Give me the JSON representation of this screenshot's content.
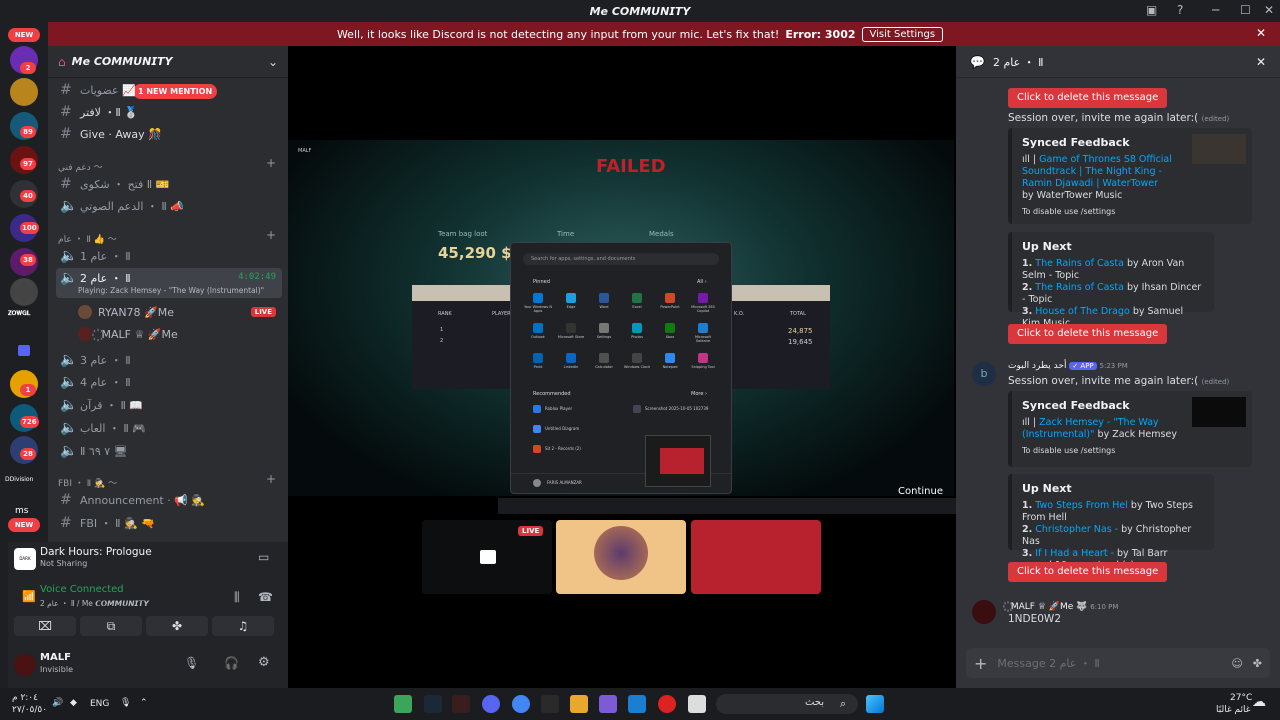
{
  "window": {
    "title": "Me 𝘾𝙊𝙈𝙈𝙐𝙉𝙄𝙏𝙔",
    "minimize": "─",
    "maximize": "☐",
    "close": "✕"
  },
  "banner": {
    "message": "Well, it looks like Discord is not detecting any input from your mic. Let's fix that!",
    "error": "Error: 3002",
    "button": "Visit Settings"
  },
  "servers": [
    {
      "badge": "NEW"
    },
    {
      "badge": "2"
    },
    {
      "badge": ""
    },
    {
      "badge": "89"
    },
    {
      "badge": "97"
    },
    {
      "badge": "40"
    },
    {
      "badge": "100"
    },
    {
      "badge": "38"
    },
    {
      "badge": "",
      "label": "𝐙𝐎𝐖𝐆𝐋"
    },
    {
      "badge": ""
    },
    {
      "badge": "1"
    },
    {
      "badge": "726"
    },
    {
      "badge": "28"
    },
    {
      "badge": "",
      "label": "DDivision"
    },
    {
      "badge": "NEW",
      "label": "ms"
    }
  ],
  "server_name": "Me 𝘾𝙊𝙈𝙈𝙐𝙉𝙄𝙏𝙔",
  "mention_pill": "1 NEW MENTION",
  "channels": [
    {
      "icon": "#",
      "name": "عضويات 📈"
    },
    {
      "icon": "#",
      "name": "لافتر ・Ⅱ 🥈"
    },
    {
      "icon": "#",
      "name": "Give · Away 🎊"
    },
    {
      "icon": "cat",
      "name": "دعم فني 〜"
    },
    {
      "icon": "#",
      "name": "فتح ・ شكوى Ⅱ 🎫"
    },
    {
      "icon": "spk",
      "name": "الدعم الصوتي ・ Ⅱ 📣"
    },
    {
      "icon": "cat",
      "name": "عام ・ Ⅱ 👍 〜"
    },
    {
      "icon": "spk",
      "name": "عام 1 ・ Ⅱ"
    },
    {
      "icon": "spk",
      "name": "عام 2 ・ Ⅱ"
    },
    {
      "icon": "spk",
      "name": "عام 3 ・ Ⅱ"
    },
    {
      "icon": "spk",
      "name": "عام 4 ・ Ⅱ"
    },
    {
      "icon": "spk",
      "name": "قرآن ・ Ⅱ 📖"
    },
    {
      "icon": "spk",
      "name": "العاب ・ Ⅱ 🎮"
    },
    {
      "icon": "spk",
      "name": "Ⅱ ٧ ٦٩ 🖥"
    },
    {
      "icon": "cat",
      "name": "FBI ・ Ⅱ 🕵 〜"
    },
    {
      "icon": "#",
      "name": "Announcement · 📢 🕵"
    },
    {
      "icon": "#",
      "name": "FBI ・ Ⅱ 🕵 🔫"
    }
  ],
  "active_channel": {
    "timer": "4:02:49",
    "activity": "Playing: Zack Hemsey - \"The Way (Instrumental)\""
  },
  "voice_users": [
    {
      "name": "RYAN78 🚀Me",
      "live": "LIVE"
    },
    {
      "name": "꙰ MALF ♕ 🚀Me",
      "live": ""
    }
  ],
  "activity": {
    "title": "Dark Hours: Prologue",
    "subtitle": "Not Sharing",
    "icon_text": "DARK HOURS"
  },
  "voice": {
    "status": "Voice Connected",
    "location": "عام 2 ・ Ⅱ / Me 𝘾𝙊𝙈𝙈𝙐𝙉𝙄𝙏𝙔"
  },
  "user": {
    "name": "MALF",
    "status": "Invisible"
  },
  "game": {
    "failed": "FAILED",
    "loot_label": "Team bag loot",
    "loot": "45,290 $",
    "time_label": "Time",
    "medals_label": "Medals",
    "col_rank": "RANK",
    "col_player": "PLAYER",
    "col_ko": "K.O.",
    "col_total": "TOTAL",
    "rows": [
      {
        "rank": "1",
        "total": "24,875"
      },
      {
        "rank": "2",
        "total": "19,645"
      }
    ],
    "continue": "Continue",
    "hud_name": "MALF"
  },
  "startmenu": {
    "search": "Search for apps, settings, and documents",
    "pinned": "Pinned",
    "all": "All ›",
    "recommended": "Recommended",
    "more": "More ›",
    "user": "FARIS ALMANZAR",
    "apps": [
      "Your Windows N Apps",
      "Edge",
      "Word",
      "Excel",
      "PowerPoint",
      "Microsoft 365 Copilot",
      "Outlook",
      "Microsoft Store",
      "Settings",
      "Photos",
      "Xbox",
      "Microsoft Solitaire",
      "Paint",
      "LinkedIn",
      "Calculator",
      "Windows Clock",
      "Notepad",
      "Snipping Tool"
    ],
    "recs": [
      "Roblox Player",
      "Untitled Diagram",
      "Sit 2 - Records (2)",
      "Screenshot 2025-10-05 102739"
    ]
  },
  "stream_thumbs": {
    "live": "LIVE"
  },
  "thread": {
    "title": "عام 2 ・ Ⅱ",
    "delete_label": "Click to delete this message",
    "session_over": "Session over, invite me again later:(",
    "edited": "(edited)",
    "bot_name": "أحد يطرد البوت",
    "app_tag": "✓ APP",
    "bot_time": "5:23 PM",
    "embed1": {
      "title": "Synced Feedback",
      "link": "Game of Thrones S8 Official Soundtrack | The Night King - Ramin Djawadi | WaterTower",
      "by": " by WaterTower Music",
      "footer": "To disable use /settings"
    },
    "upnext1": {
      "title": "Up Next",
      "items": [
        [
          "1.",
          "The Rains of Casta",
          " by Aron Van Selm - Topic"
        ],
        [
          "2.",
          "The Rains of Casta",
          " by Ihsan Dincer - Topic"
        ],
        [
          "3.",
          "House of The Drago",
          " by Samuel Kim Music"
        ]
      ],
      "more": "... and 20 more track(s)"
    },
    "embed2": {
      "title": "Synced Feedback",
      "link": "Zack Hemsey - \"The Way (Instrumental)\"",
      "by": " by Zack Hemsey",
      "footer": "To disable use /settings"
    },
    "upnext2": {
      "title": "Up Next",
      "items": [
        [
          "1.",
          "Two Steps From Hel",
          " by Two Steps From Hell"
        ],
        [
          "2.",
          "Christopher Nas -",
          " by Christopher Nas"
        ],
        [
          "3.",
          "If I Had a Heart -",
          " by Tal Barr"
        ]
      ],
      "more": "... and 10 more track(s)"
    },
    "user_name": "꙰ MALF ♕ 🚀Me 🐺",
    "user_time": "6:10 PM",
    "user_msg": "1NDE0W2",
    "placeholder": "Message عام 2 ・ Ⅱ"
  },
  "taskbar": {
    "time": "٢:٠٤ م",
    "date": "٢٧/٠٥/٥٠",
    "lang": "ENG",
    "search": "بحث",
    "temp": "27°C",
    "weather": "غائم غالبًا"
  },
  "colors": {
    "accent": "#5865f2",
    "danger": "#da373c",
    "online": "#23a55a",
    "link": "#00a8fc"
  }
}
